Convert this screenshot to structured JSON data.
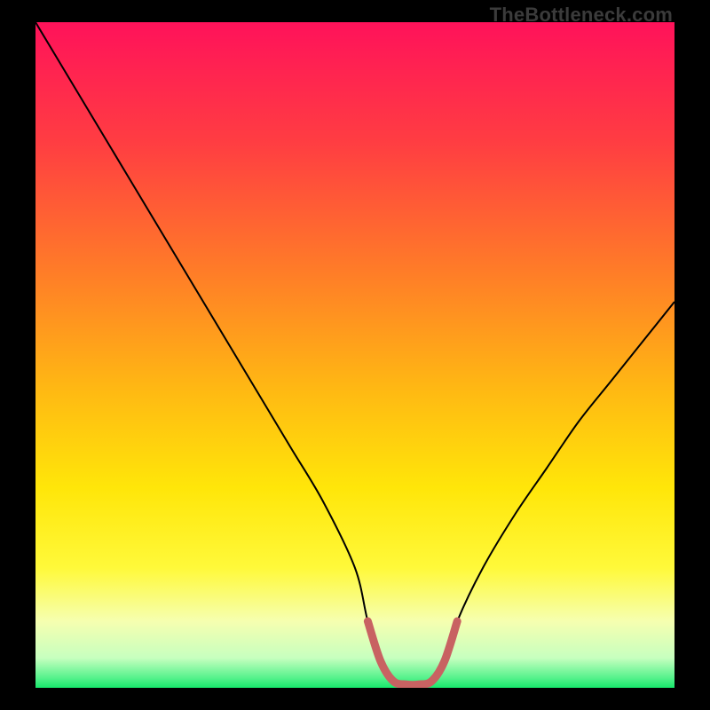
{
  "watermark": "TheBottleneck.com",
  "chart_data": {
    "type": "line",
    "title": "",
    "xlabel": "",
    "ylabel": "",
    "xlim": [
      0,
      100
    ],
    "ylim": [
      0,
      100
    ],
    "x": [
      0,
      5,
      10,
      15,
      20,
      25,
      30,
      35,
      40,
      45,
      50,
      52,
      54,
      56,
      58,
      60,
      62,
      64,
      66,
      70,
      75,
      80,
      85,
      90,
      95,
      100
    ],
    "values": [
      100,
      92,
      84,
      76,
      68,
      60,
      52,
      44,
      36,
      28,
      18,
      10,
      4,
      1,
      0.5,
      0.5,
      1,
      4,
      10,
      18,
      26,
      33,
      40,
      46,
      52,
      58
    ],
    "annotations": [
      {
        "label": "highlight-band",
        "x_start": 52,
        "x_end": 66,
        "color": "#c86262"
      }
    ],
    "background_gradient": {
      "stops": [
        {
          "offset": 0.0,
          "color": "#ff125a"
        },
        {
          "offset": 0.18,
          "color": "#ff3d42"
        },
        {
          "offset": 0.38,
          "color": "#ff7e27"
        },
        {
          "offset": 0.55,
          "color": "#ffb813"
        },
        {
          "offset": 0.7,
          "color": "#ffe609"
        },
        {
          "offset": 0.82,
          "color": "#fff93a"
        },
        {
          "offset": 0.9,
          "color": "#f6ffb0"
        },
        {
          "offset": 0.955,
          "color": "#c7ffbf"
        },
        {
          "offset": 0.985,
          "color": "#56f28c"
        },
        {
          "offset": 1.0,
          "color": "#17e86b"
        }
      ]
    }
  }
}
